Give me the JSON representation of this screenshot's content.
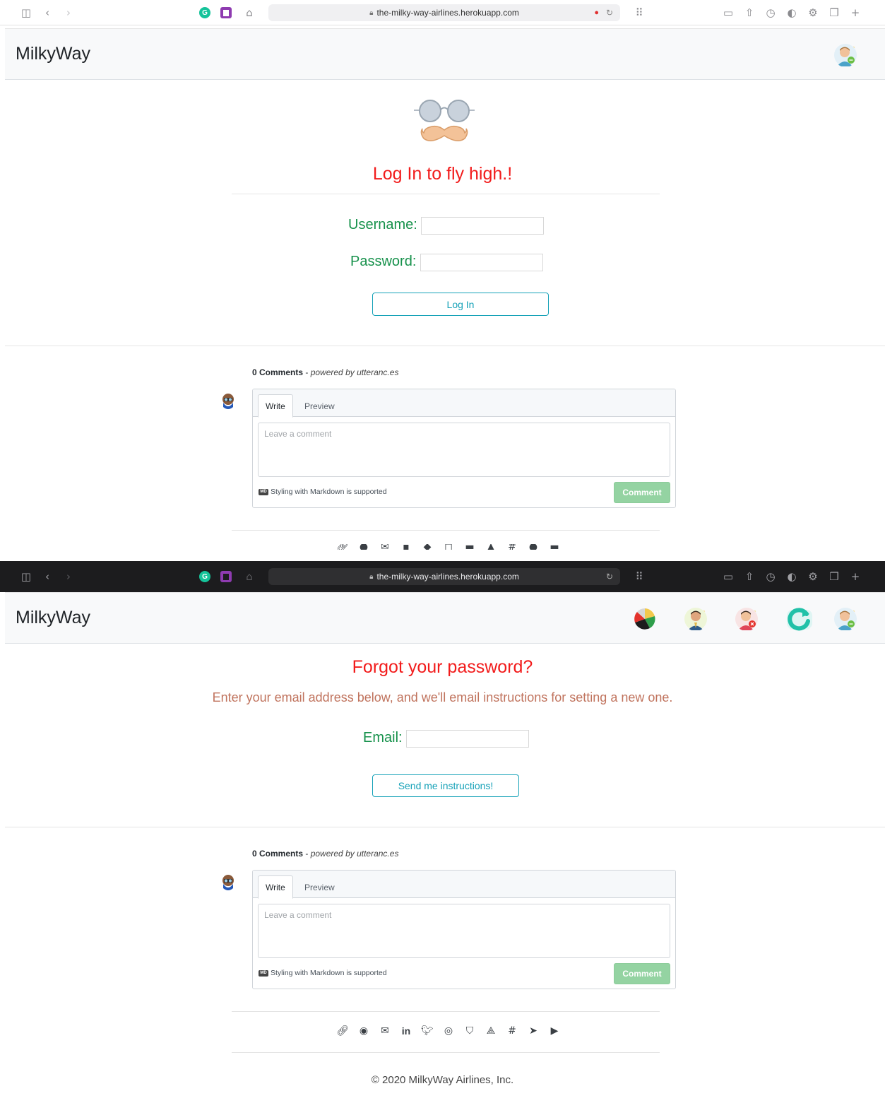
{
  "browser": {
    "url": "the-milky-way-airlines.herokuapp.com",
    "grammarly_letter": "G"
  },
  "brand": "MilkyWay",
  "login": {
    "title": "Log In to fly high.!",
    "username_label": "Username:",
    "password_label": "Password:",
    "button": "Log In"
  },
  "forgot": {
    "title": "Forgot your password?",
    "subtitle": "Enter your email address below, and we'll email instructions for setting a new one.",
    "email_label": "Email:",
    "button": "Send me instructions!"
  },
  "comments": {
    "count": "0 Comments",
    "sep": " - ",
    "powered": "powered by utteranc.es",
    "tab_write": "Write",
    "tab_preview": "Preview",
    "placeholder": "Leave a comment",
    "markdown_badge": "MD",
    "markdown": "Styling with Markdown is supported",
    "button": "Comment"
  },
  "social_icons": [
    "link-icon",
    "github-icon",
    "mail-icon",
    "linkedin-icon",
    "twitter-icon",
    "instagram-icon",
    "pocket-icon",
    "gitlab-icon",
    "slack-icon",
    "telegram-icon",
    "youtube-icon"
  ],
  "footer": "© 2020 MilkyWay Airlines, Inc.",
  "colors": {
    "title_red": "#f21b1b",
    "label_green": "#16914b",
    "button_teal": "#17a2b8",
    "comment_green": "#94d3a2"
  }
}
